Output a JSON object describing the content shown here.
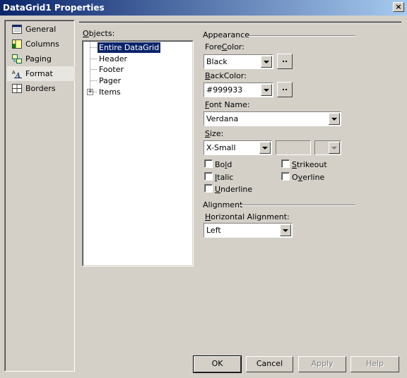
{
  "window": {
    "title": "DataGrid1 Properties",
    "close_glyph": "×"
  },
  "nav": {
    "items": [
      {
        "label": "General",
        "icon": "general-icon"
      },
      {
        "label": "Columns",
        "icon": "columns-icon"
      },
      {
        "label": "Paging",
        "icon": "paging-icon"
      },
      {
        "label": "Format",
        "icon": "format-icon",
        "selected": true
      },
      {
        "label": "Borders",
        "icon": "borders-icon"
      }
    ]
  },
  "objects": {
    "label_prefix": "",
    "label_accel": "O",
    "label_rest": "bjects:",
    "tree": [
      {
        "label": "Entire DataGrid",
        "selected": true
      },
      {
        "label": "Header"
      },
      {
        "label": "Footer"
      },
      {
        "label": "Pager"
      },
      {
        "label": "Items",
        "expandable": true
      }
    ]
  },
  "appearance": {
    "title": "Appearance",
    "forecolor": {
      "label_a": "Fore",
      "label_accel": "C",
      "label_b": "olor:",
      "value": "Black"
    },
    "backcolor": {
      "label_a": "",
      "label_accel": "B",
      "label_b": "ackColor:",
      "value": "#999933"
    },
    "fontname": {
      "label_a": "",
      "label_accel": "F",
      "label_b": "ont Name:",
      "value": "Verdana"
    },
    "size": {
      "label_a": "",
      "label_accel": "S",
      "label_b": "ize:",
      "value": "X-Small"
    },
    "dots": "..",
    "checks": {
      "bold": {
        "a": "Bo",
        "accel": "l",
        "b": "d"
      },
      "italic": {
        "a": "",
        "accel": "I",
        "b": "talic"
      },
      "underline": {
        "a": "",
        "accel": "U",
        "b": "nderline"
      },
      "strikeout": {
        "a": "",
        "accel": "S",
        "b": "trikeout"
      },
      "overline": {
        "a": "O",
        "accel": "v",
        "b": "erline"
      }
    }
  },
  "alignment": {
    "title": "Alignment",
    "horizontal": {
      "label_a": "",
      "label_accel": "H",
      "label_b": "orizontal Alignment:",
      "value": "Left"
    }
  },
  "buttons": {
    "ok": "OK",
    "cancel": "Cancel",
    "apply": "Apply",
    "help": "Help"
  }
}
